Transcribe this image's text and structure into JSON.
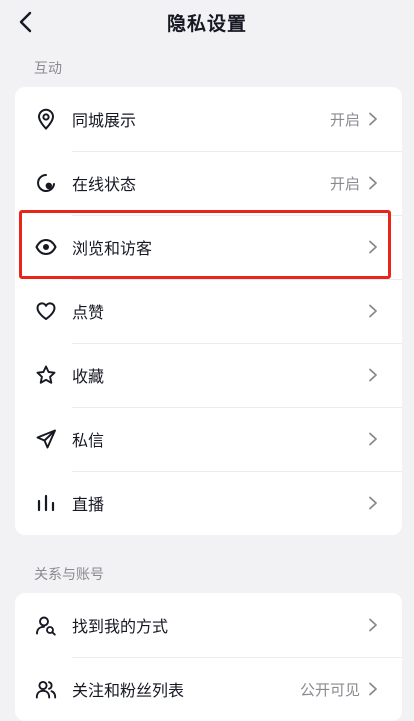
{
  "header": {
    "title": "隐私设置"
  },
  "sections": [
    {
      "label": "互动",
      "items": [
        {
          "icon": "location-pin-icon",
          "label": "同城展示",
          "value": "开启"
        },
        {
          "icon": "online-status-icon",
          "label": "在线状态",
          "value": "开启"
        },
        {
          "icon": "eye-icon",
          "label": "浏览和访客",
          "value": ""
        },
        {
          "icon": "heart-icon",
          "label": "点赞",
          "value": ""
        },
        {
          "icon": "star-icon",
          "label": "收藏",
          "value": ""
        },
        {
          "icon": "send-icon",
          "label": "私信",
          "value": ""
        },
        {
          "icon": "live-bars-icon",
          "label": "直播",
          "value": ""
        }
      ]
    },
    {
      "label": "关系与账号",
      "items": [
        {
          "icon": "search-person-icon",
          "label": "找到我的方式",
          "value": ""
        },
        {
          "icon": "users-icon",
          "label": "关注和粉丝列表",
          "value": "公开可见"
        }
      ]
    }
  ],
  "colors": {
    "highlight": "#e8241b",
    "background": "#f2f2f4",
    "secondary_text": "#8a8b91"
  }
}
